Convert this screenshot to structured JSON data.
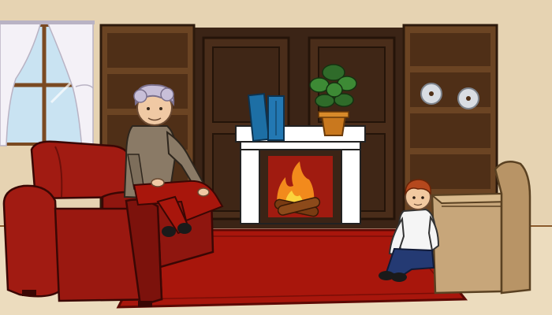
{
  "scene": {
    "name": "living-room",
    "characters": [
      "grandmother",
      "boy"
    ],
    "objects": [
      "window",
      "curtains",
      "left-bookshelf",
      "right-bookshelf",
      "back-cabinet",
      "fireplace",
      "potted-plant",
      "blue-books",
      "discs",
      "armchair",
      "rug",
      "cardboard-box"
    ]
  },
  "colors": {
    "wall": "#e6d3b2",
    "wall_shadow": "#d8c29e",
    "floor": "#ecdcbe",
    "baseboard": "#8a5a2b",
    "dark_wood": "#3b2416",
    "shelf_wood": "#6b4423",
    "shelf_inner": "#4f2f17",
    "sofa_red": "#a11b12",
    "sofa_dark": "#6e0f0a",
    "rug_red": "#a8160c",
    "fire_orange": "#f28a1c",
    "book_blue": "#1d6fa5",
    "plant_green": "#2f6b2a",
    "pot": "#c9781e",
    "box_tan": "#c7a67a",
    "window_glass": "#c9e3f2",
    "curtain": "#f4f1f7"
  }
}
